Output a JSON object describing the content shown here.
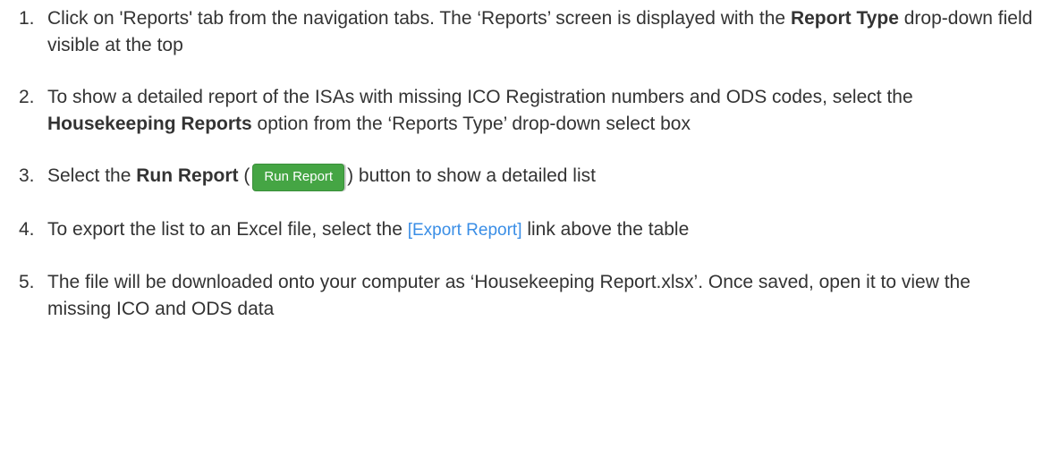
{
  "steps": [
    {
      "number": "1.",
      "text_a": "Click on 'Reports' tab from the navigation tabs. The ‘Reports’ screen is displayed with the ",
      "bold_a": "Report Type",
      "text_b": " drop-down field visible at the top"
    },
    {
      "number": "2.",
      "text_a": "To show a detailed report of the ISAs with missing ICO Registration numbers and ODS codes, select the ",
      "bold_a": "Housekeeping Reports",
      "text_b": "  option from the ‘Reports Type’ drop-down select box"
    },
    {
      "number": "3.",
      "text_a": "Select the ",
      "bold_a": "Run Report",
      "text_b": " (",
      "button_label": "Run Report",
      "text_c": ") button to show a detailed list"
    },
    {
      "number": "4.",
      "text_a": "To export the list to an Excel file, select the ",
      "link_label": "[Export Report]",
      "text_b": " link above the table"
    },
    {
      "number": "5.",
      "text_a": "The file will be downloaded onto your computer as ‘Housekeeping Report.xlsx’. Once saved, open it to view the missing ICO and ODS data"
    }
  ],
  "colors": {
    "button_bg": "#45a544",
    "link": "#3a8ee6",
    "text": "#333333"
  }
}
